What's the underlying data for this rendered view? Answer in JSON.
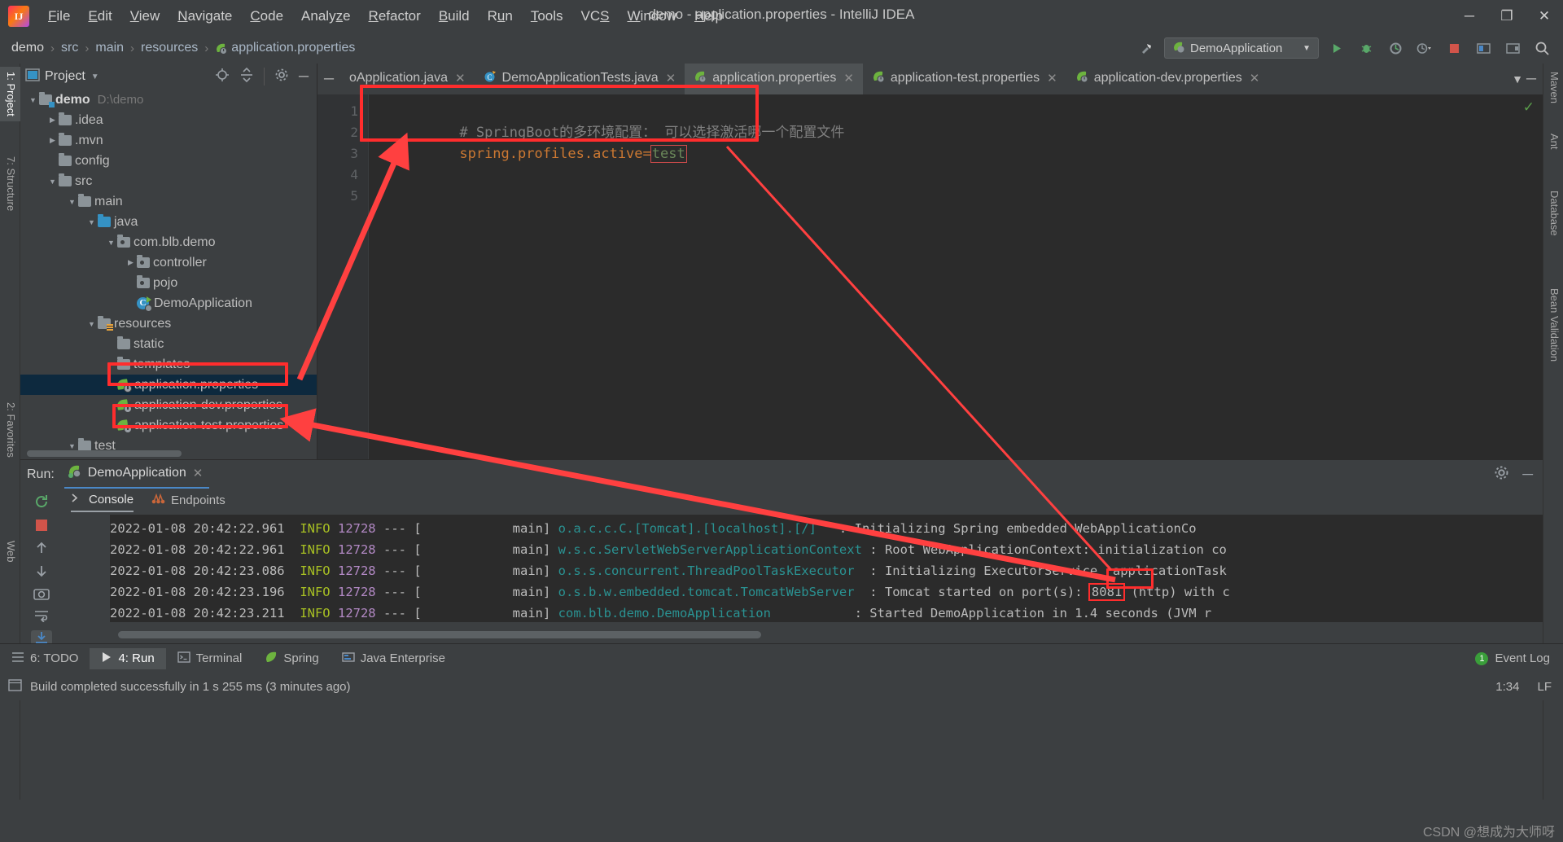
{
  "window": {
    "title": "demo - application.properties - IntelliJ IDEA",
    "minimize": "─",
    "maximize": "❐",
    "close": "✕"
  },
  "menu": {
    "items": [
      "File",
      "Edit",
      "View",
      "Navigate",
      "Code",
      "Analyze",
      "Refactor",
      "Build",
      "Run",
      "Tools",
      "VCS",
      "Window",
      "Help"
    ]
  },
  "breadcrumb": {
    "items": [
      "demo",
      "src",
      "main",
      "resources",
      "application.properties"
    ],
    "separator": "›"
  },
  "toolbar": {
    "run_config": "DemoApplication",
    "hammer_icon": "build-icon",
    "run_icon": "▶",
    "debug_icon": "debug-icon",
    "coverage_icon": "coverage-icon",
    "profile_icon": "profile-icon",
    "stop_icon": "■",
    "search_icon": "⌕",
    "settings_icon": "⚙"
  },
  "left_strip": {
    "tabs": [
      "1: Project",
      "7: Structure"
    ],
    "favorites": "2: Favorites",
    "web": "Web"
  },
  "right_strip": {
    "tabs": [
      "Maven",
      "Ant",
      "Database",
      "Bean Validation"
    ]
  },
  "project_panel": {
    "title": "Project",
    "icons": [
      "locate-icon",
      "collapse-all-icon",
      "settings-icon",
      "hide-icon"
    ],
    "tree": [
      {
        "depth": 0,
        "arrow": "down",
        "icon": "module-folder",
        "label": "demo",
        "bold": true,
        "path": "D:\\demo"
      },
      {
        "depth": 1,
        "arrow": "right",
        "icon": "folder",
        "label": ".idea"
      },
      {
        "depth": 1,
        "arrow": "right",
        "icon": "folder",
        "label": ".mvn"
      },
      {
        "depth": 1,
        "arrow": "none",
        "icon": "folder",
        "label": "config"
      },
      {
        "depth": 1,
        "arrow": "down",
        "icon": "folder",
        "label": "src"
      },
      {
        "depth": 2,
        "arrow": "down",
        "icon": "folder",
        "label": "main"
      },
      {
        "depth": 3,
        "arrow": "down",
        "icon": "source-folder",
        "label": "java"
      },
      {
        "depth": 4,
        "arrow": "down",
        "icon": "package",
        "label": "com.blb.demo"
      },
      {
        "depth": 5,
        "arrow": "right",
        "icon": "package",
        "label": "controller"
      },
      {
        "depth": 5,
        "arrow": "none",
        "icon": "package",
        "label": "pojo"
      },
      {
        "depth": 5,
        "arrow": "none",
        "icon": "spring-class",
        "label": "DemoApplication"
      },
      {
        "depth": 3,
        "arrow": "down",
        "icon": "resource-folder",
        "label": "resources"
      },
      {
        "depth": 4,
        "arrow": "none",
        "icon": "folder",
        "label": "static"
      },
      {
        "depth": 4,
        "arrow": "none",
        "icon": "folder",
        "label": "templates"
      },
      {
        "depth": 4,
        "arrow": "none",
        "icon": "spring-properties",
        "label": "application.properties",
        "selected": true,
        "highlighted": true
      },
      {
        "depth": 4,
        "arrow": "none",
        "icon": "spring-properties",
        "label": "application-dev.properties"
      },
      {
        "depth": 4,
        "arrow": "none",
        "icon": "spring-properties",
        "label": "application-test.properties",
        "highlighted": true
      },
      {
        "depth": 2,
        "arrow": "down",
        "icon": "folder",
        "label": "test"
      }
    ]
  },
  "editor": {
    "tabs": [
      {
        "label": "oApplication.java",
        "icon": "java-class-icon",
        "active": false,
        "truncated": true
      },
      {
        "label": "DemoApplicationTests.java",
        "icon": "test-class-icon",
        "active": false
      },
      {
        "label": "application.properties",
        "icon": "spring-properties-icon",
        "active": true
      },
      {
        "label": "application-test.properties",
        "icon": "spring-properties-icon",
        "active": false
      },
      {
        "label": "application-dev.properties",
        "icon": "spring-properties-icon",
        "active": false
      }
    ],
    "gutter_lines": [
      "1",
      "2",
      "3",
      "4",
      "5"
    ],
    "content": {
      "line1_comment": "# SpringBoot的多环境配置： 可以选择激活哪一个配置文件",
      "line2_key": "spring.profiles.active",
      "line2_eq": "=",
      "line2_value": "test"
    },
    "inspection_status": "✓"
  },
  "run_window": {
    "label": "Run:",
    "config_name": "DemoApplication",
    "close_icon": "✕",
    "settings_icon": "⚙",
    "minimize_icon": "─",
    "subtabs": [
      {
        "label": "Console",
        "icon": "console-icon",
        "active": true
      },
      {
        "label": "Endpoints",
        "icon": "endpoints-icon",
        "active": false
      }
    ],
    "rail_icons": [
      "rerun-icon",
      "stop-icon",
      "up-icon",
      "down-icon",
      "camera-icon",
      "soft-wrap-icon",
      "scroll-to-end-icon"
    ],
    "console_lines": [
      {
        "ts": "2022-01-08 20:42:22.961",
        "level": "INFO",
        "pid": "12728",
        "thread": "main",
        "logger": "o.a.c.c.C.[Tomcat].[localhost].[/]",
        "msg": "Initializing Spring embedded WebApplicationCo"
      },
      {
        "ts": "2022-01-08 20:42:22.961",
        "level": "INFO",
        "pid": "12728",
        "thread": "main",
        "logger": "w.s.c.ServletWebServerApplicationContext",
        "msg": "Root WebApplicationContext: initialization co"
      },
      {
        "ts": "2022-01-08 20:42:23.086",
        "level": "INFO",
        "pid": "12728",
        "thread": "main",
        "logger": "o.s.s.concurrent.ThreadPoolTaskExecutor",
        "msg": "Initializing ExecutorService 'applicationTask"
      },
      {
        "ts": "2022-01-08 20:42:23.196",
        "level": "INFO",
        "pid": "12728",
        "thread": "main",
        "logger": "o.s.b.w.embedded.tomcat.TomcatWebServer",
        "msg_pre": "Tomcat started on port(s): ",
        "port": "8081",
        "msg_post": " (http) with c"
      },
      {
        "ts": "2022-01-08 20:42:23.211",
        "level": "INFO",
        "pid": "12728",
        "thread": "main",
        "logger": "com.blb.demo.DemoApplication",
        "msg": "Started DemoApplication in 1.4 seconds (JVM r"
      }
    ]
  },
  "bottom_bar": {
    "items": [
      {
        "label": "6: TODO",
        "icon": "todo-icon",
        "active": false
      },
      {
        "label": "4: Run",
        "icon": "run-icon",
        "active": true
      },
      {
        "label": "Terminal",
        "icon": "terminal-icon",
        "active": false
      },
      {
        "label": "Spring",
        "icon": "spring-icon",
        "active": false
      },
      {
        "label": "Java Enterprise",
        "icon": "java-ee-icon",
        "active": false
      }
    ],
    "event_log": "Event Log",
    "event_count": "1"
  },
  "status_bar": {
    "message": "Build completed successfully in 1 s 255 ms (3 minutes ago)",
    "caret_position": "1:34",
    "line_separator": "LF",
    "watermark": "CSDN @想成为大师呀"
  },
  "colors": {
    "accent_red": "#ff2d2d",
    "selection_blue": "#0d293e",
    "editor_bg": "#2b2b2b",
    "panel_bg": "#3c3f41"
  }
}
